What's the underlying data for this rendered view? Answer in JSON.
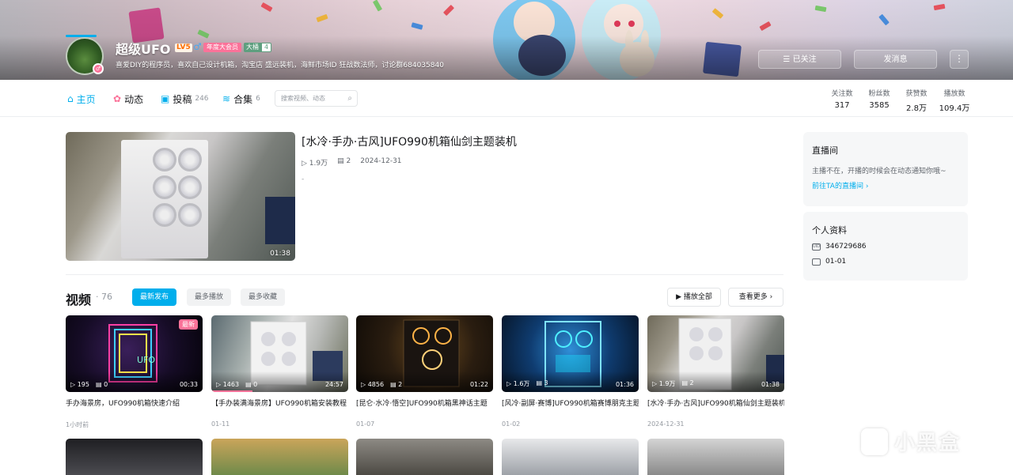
{
  "header": {
    "username": "超级UFO",
    "level": "LV5",
    "gender_icon": "male-icon",
    "vip_label": "年度大会员",
    "medal_name": "大桶",
    "medal_level": "4",
    "signature": "喜爱DIY的程序员，喜欢自己设计机箱，淘宝店 盛远装机，海鲜市场ID 狂战数法师，讨论群684035840",
    "follow_label": "已关注",
    "message_label": "发消息",
    "more_label": "⋮"
  },
  "nav": {
    "tabs": [
      {
        "label": "主页",
        "icon": "home-icon"
      },
      {
        "label": "动态",
        "icon": "dynamic-icon"
      },
      {
        "label": "投稿",
        "count": "246",
        "icon": "posts-icon"
      },
      {
        "label": "合集",
        "count": "6",
        "icon": "collections-icon"
      }
    ],
    "search_placeholder": "搜索视频、动态"
  },
  "stats": [
    {
      "label": "关注数",
      "value": "317"
    },
    {
      "label": "粉丝数",
      "value": "3585"
    },
    {
      "label": "获赞数",
      "value": "2.8万"
    },
    {
      "label": "播放数",
      "value": "109.4万"
    }
  ],
  "featured": {
    "title": "[水冷·手办·古风]UFO990机箱仙剑主题装机",
    "plays": "1.9万",
    "comments": "2",
    "date": "2024-12-31",
    "desc": "-",
    "duration": "01:38"
  },
  "videos_section": {
    "title": "视频",
    "count": "· 76",
    "sort_latest": "最新发布",
    "sort_plays": "最多播放",
    "sort_favs": "最多收藏",
    "play_all": "▶ 播放全部",
    "see_more": "查看更多 ›"
  },
  "videos": [
    {
      "title": "手办海景房，UFO990机箱快速介绍",
      "plays": "195",
      "comments": "0",
      "duration": "00:33",
      "date": "1小时前",
      "tag": "最新"
    },
    {
      "title": "【手办装满海景房】UFO990机箱安装教程",
      "plays": "1463",
      "comments": "0",
      "duration": "24:57",
      "date": "01-11",
      "progress": 0.3
    },
    {
      "title": "[昆仑·水冷·悟空]UFO990机箱黑神话主题",
      "plays": "4856",
      "comments": "2",
      "duration": "01:22",
      "date": "01-07"
    },
    {
      "title": "[风冷·副屏·赛博]UFO990机箱赛博朋克主题",
      "plays": "1.6万",
      "comments": "3",
      "duration": "01:36",
      "date": "01-02"
    },
    {
      "title": "[水冷·手办·古风]UFO990机箱仙剑主题装机",
      "plays": "1.9万",
      "comments": "2",
      "duration": "01:38",
      "date": "2024-12-31"
    }
  ],
  "sidebar": {
    "live_title": "直播间",
    "live_text": "主播不在，开播的时候会在动态通知你哦~",
    "live_link": "前往TA的直播间 ›",
    "profile_title": "个人资料",
    "uid": "346729686",
    "birthday": "01-01"
  },
  "watermark": "小黑盒",
  "colors": {
    "accent": "#00aeec",
    "pink": "#fb7299"
  }
}
